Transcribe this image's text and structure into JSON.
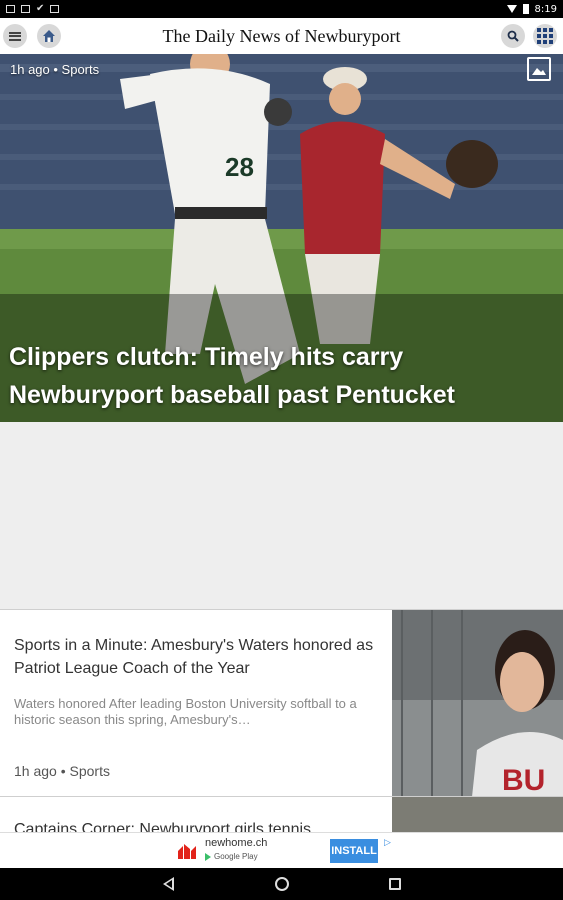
{
  "status_bar": {
    "time": "8:19"
  },
  "app_bar": {
    "title": "The Daily News of Newburyport"
  },
  "hero": {
    "meta": "1h ago • Sports",
    "title": "Clippers clutch: Timely hits carry Newburyport baseball past Pentucket"
  },
  "stories": [
    {
      "title": "Sports in a Minute: Amesbury's Waters honored as Patriot League Coach of the Year",
      "summary": "Waters honored After leading Boston University softball to a historic season this spring, Amesbury's…",
      "meta": "1h ago • Sports"
    },
    {
      "title": "Captains Corner: Newburyport girls tennis"
    }
  ],
  "ad": {
    "domain": "newhome.ch",
    "store": "Google Play",
    "install_label": "INSTALL"
  },
  "colors": {
    "accent": "#1f3f78",
    "install_blue": "#3a8ee0",
    "ad_logo_red": "#e2231a"
  },
  "icons": [
    "menu-icon",
    "home-icon",
    "search-icon",
    "grid-icon",
    "gallery-icon",
    "back-icon",
    "home-nav-icon",
    "recents-icon"
  ]
}
